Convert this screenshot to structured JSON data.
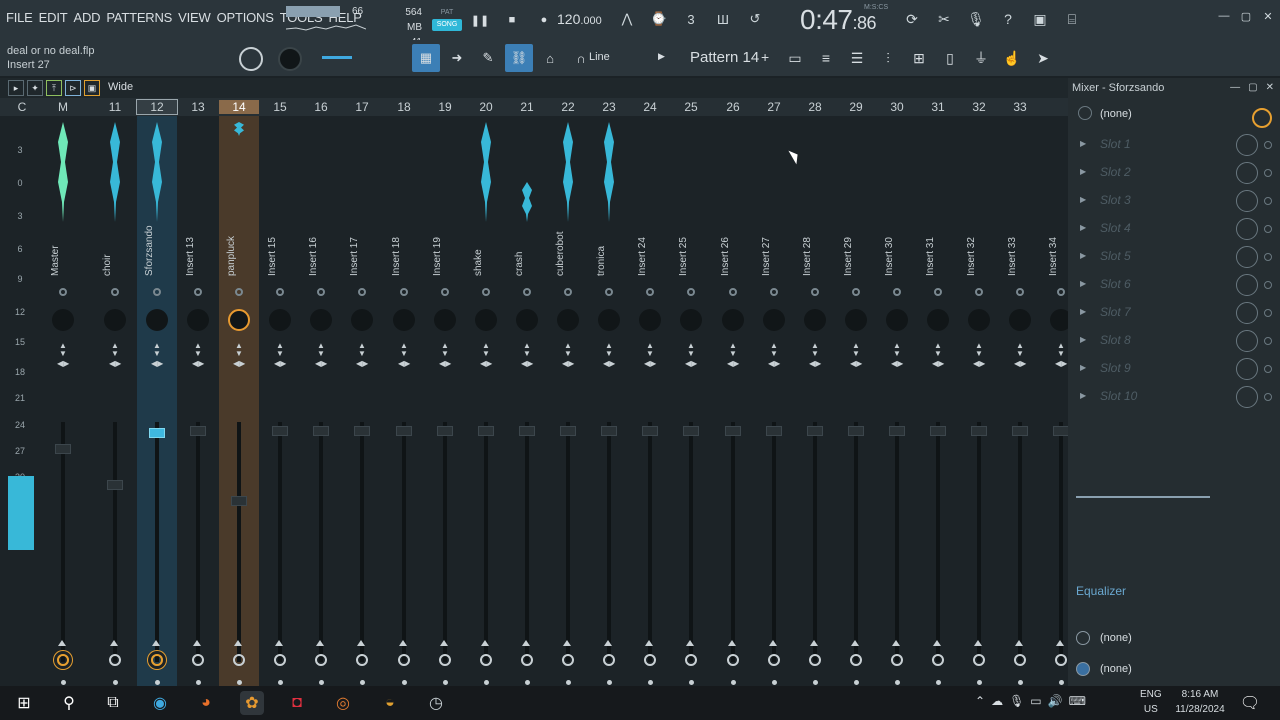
{
  "menu": [
    "FILE",
    "EDIT",
    "ADD",
    "PATTERNS",
    "VIEW",
    "OPTIONS",
    "TOOLS",
    "HELP"
  ],
  "meter": {
    "value": "66"
  },
  "memory": {
    "mb": "564 MB",
    "num": "41"
  },
  "mode": {
    "pat": "PAT",
    "song": "SONG"
  },
  "tempo": {
    "main": "120",
    "frac": ".000"
  },
  "time": {
    "main": "0:47",
    "sub": ":86",
    "label": "M:S:CS"
  },
  "hint": {
    "file": "deal or no deal.flp",
    "insert": "Insert 27"
  },
  "toolbar": {
    "snap": "Line",
    "pattern": "Pattern 14"
  },
  "mixer": {
    "view": "Wide",
    "title": "Mixer - Sforzsando",
    "channels": [
      {
        "num": "C",
        "label": "",
        "w": false
      },
      {
        "num": "M",
        "label": "Master"
      },
      {
        "num": "11",
        "label": "choir"
      },
      {
        "num": "12",
        "label": "Sforzsando"
      },
      {
        "num": "13",
        "label": "Insert 13"
      },
      {
        "num": "14",
        "label": "panpluck"
      },
      {
        "num": "15",
        "label": "Insert 15"
      },
      {
        "num": "16",
        "label": "Insert 16"
      },
      {
        "num": "17",
        "label": "Insert 17"
      },
      {
        "num": "18",
        "label": "Insert 18"
      },
      {
        "num": "19",
        "label": "Insert 19"
      },
      {
        "num": "20",
        "label": "shake"
      },
      {
        "num": "21",
        "label": "crash"
      },
      {
        "num": "22",
        "label": "cuberobot"
      },
      {
        "num": "23",
        "label": "tronica"
      },
      {
        "num": "24",
        "label": "Insert 24"
      },
      {
        "num": "25",
        "label": "Insert 25"
      },
      {
        "num": "26",
        "label": "Insert 26"
      },
      {
        "num": "27",
        "label": "Insert 27"
      },
      {
        "num": "28",
        "label": "Insert 28"
      },
      {
        "num": "29",
        "label": "Insert 29"
      },
      {
        "num": "30",
        "label": "Insert 30"
      },
      {
        "num": "31",
        "label": "Insert 31"
      },
      {
        "num": "32",
        "label": "Insert 32"
      },
      {
        "num": "33",
        "label": "Insert 33"
      },
      {
        "num": "",
        "label": "Insert 34"
      }
    ],
    "scale": [
      "3",
      "0",
      "3",
      "6",
      "9",
      "12",
      "15",
      "18",
      "21",
      "24",
      "27",
      "30"
    ]
  },
  "side": {
    "input": "(none)",
    "slots": [
      "Slot 1",
      "Slot 2",
      "Slot 3",
      "Slot 4",
      "Slot 5",
      "Slot 6",
      "Slot 7",
      "Slot 8",
      "Slot 9",
      "Slot 10"
    ],
    "eq": "Equalizer",
    "out1": "(none)",
    "out2": "(none)"
  },
  "taskbar": {
    "lang1": "ENG",
    "lang2": "US",
    "time": "8:16 AM",
    "date": "11/28/2024"
  },
  "colors": {
    "accent": "#3fb8e0",
    "orange": "#e89a30",
    "bg": "#1c2327"
  }
}
